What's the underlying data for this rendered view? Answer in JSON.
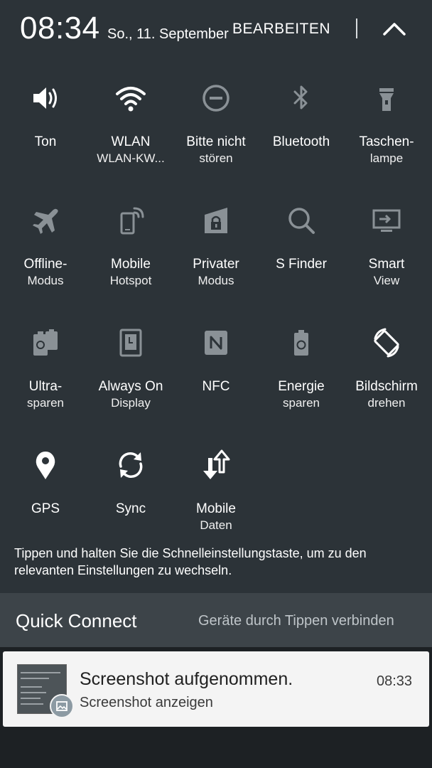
{
  "header": {
    "time": "08:34",
    "date": "So., 11. September",
    "edit_label": "BEARBEITEN"
  },
  "tiles": [
    {
      "label": "Ton",
      "sub": "",
      "icon": "speaker-icon",
      "active": true
    },
    {
      "label": "WLAN",
      "sub": "WLAN-KW...",
      "icon": "wifi-icon",
      "active": true
    },
    {
      "label": "Bitte nicht",
      "sub": "stören",
      "icon": "do-not-disturb-icon",
      "active": false
    },
    {
      "label": "Bluetooth",
      "sub": "",
      "icon": "bluetooth-icon",
      "active": false
    },
    {
      "label": "Taschen-",
      "sub": "lampe",
      "icon": "flashlight-icon",
      "active": false
    },
    {
      "label": "Offline-",
      "sub": "Modus",
      "icon": "airplane-icon",
      "active": false
    },
    {
      "label": "Mobile",
      "sub": "Hotspot",
      "icon": "hotspot-icon",
      "active": false
    },
    {
      "label": "Privater",
      "sub": "Modus",
      "icon": "private-mode-icon",
      "active": false
    },
    {
      "label": "S Finder",
      "sub": "",
      "icon": "search-icon",
      "active": false
    },
    {
      "label": "Smart",
      "sub": "View",
      "icon": "smart-view-icon",
      "active": false
    },
    {
      "label": "Ultra-",
      "sub": "sparen",
      "icon": "ultra-power-saving-icon",
      "active": false
    },
    {
      "label": "Always On",
      "sub": "Display",
      "icon": "always-on-display-icon",
      "active": false
    },
    {
      "label": "NFC",
      "sub": "",
      "icon": "nfc-icon",
      "active": false
    },
    {
      "label": "Energie",
      "sub": "sparen",
      "icon": "power-saving-icon",
      "active": false
    },
    {
      "label": "Bildschirm",
      "sub": "drehen",
      "icon": "screen-rotation-icon",
      "active": true
    },
    {
      "label": "GPS",
      "sub": "",
      "icon": "location-icon",
      "active": true
    },
    {
      "label": "Sync",
      "sub": "",
      "icon": "sync-icon",
      "active": true
    },
    {
      "label": "Mobile",
      "sub": "Daten",
      "icon": "mobile-data-icon",
      "active": true
    }
  ],
  "hint": "Tippen und halten Sie die Schnelleinstellungstaste, um zu den relevanten Einstellungen zu wechseln.",
  "quick_connect": {
    "title": "Quick Connect",
    "hint": "Geräte durch Tippen verbinden"
  },
  "notification": {
    "title": "Screenshot aufgenommen.",
    "subtitle": "Screenshot anzeigen",
    "time": "08:33"
  },
  "colors": {
    "background": "#2c3338",
    "icon_active": "#ffffff",
    "icon_inactive": "#8a9196",
    "quick_connect_bar": "#3d4449",
    "notification_bg": "#f4f4f4"
  }
}
